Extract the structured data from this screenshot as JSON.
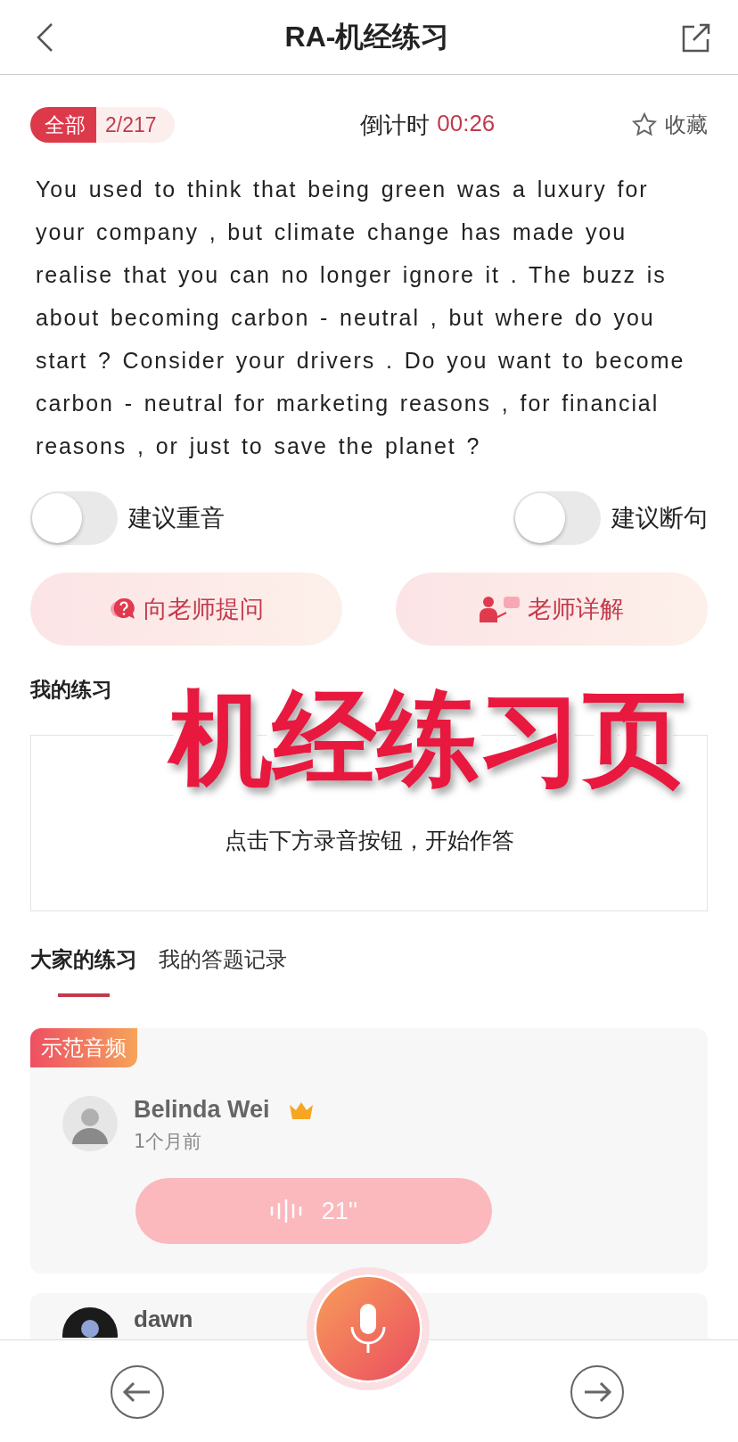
{
  "header": {
    "title": "RA-机经练习"
  },
  "status": {
    "filter_label": "全部",
    "progress": "2/217",
    "countdown_label": "倒计时",
    "countdown": "00:26",
    "favorite": {
      "label": "收藏",
      "on": false
    }
  },
  "passage": "You used to think that being green was a luxury for your company , but climate change has made you realise that you can no longer ignore it . The buzz is about becoming carbon - neutral , but where do you start ? Consider your drivers . Do you want to become carbon - neutral for marketing reasons , for financial reasons , or just to save the planet ?",
  "toggles": [
    {
      "label": "建议重音",
      "on": false
    },
    {
      "label": "建议断句",
      "on": false
    }
  ],
  "actions": [
    {
      "label": "向老师提问",
      "kind": "ask"
    },
    {
      "label": "老师详解",
      "kind": "explain"
    }
  ],
  "my_practice": {
    "title": "我的练习",
    "placeholder": "点击下方录音按钮，开始作答"
  },
  "tabs": [
    {
      "label": "大家的练习",
      "selected": true
    },
    {
      "label": "我的答题记录",
      "selected": false
    }
  ],
  "answers": [
    {
      "badge": "示范音频",
      "name": "Belinda Wei",
      "vip": true,
      "time": "1个月前",
      "duration": "21''"
    },
    {
      "name": "dawn"
    }
  ],
  "caption": "机经练习页"
}
